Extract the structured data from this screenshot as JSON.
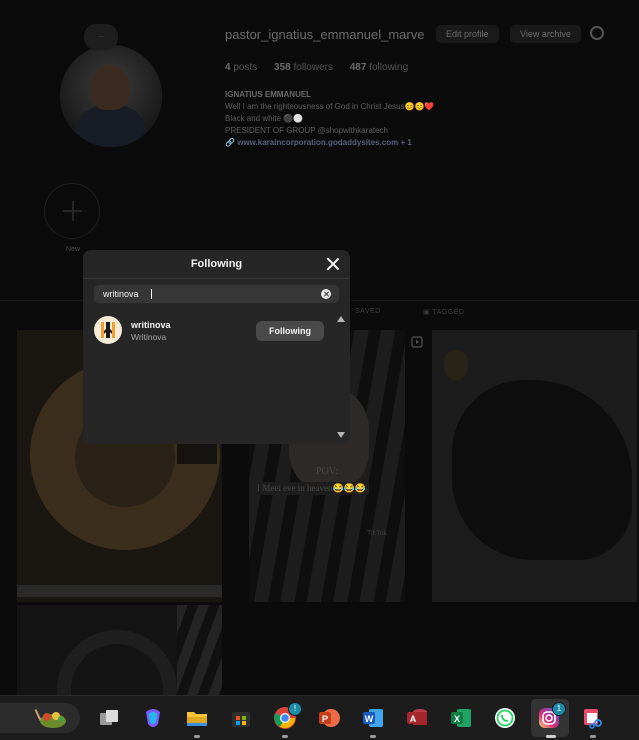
{
  "profile": {
    "username": "pastor_ignatius_emmanuel_marve",
    "edit_profile_label": "Edit profile",
    "view_archive_label": "View archive",
    "stats": {
      "posts_count": "4",
      "posts_label": "posts",
      "followers_count": "358",
      "followers_label": "followers",
      "following_count": "487",
      "following_label": "following"
    },
    "bio": {
      "name": "IGNATIUS EMMANUEL",
      "line1": "Well I am the righteousness of God in Christ Jesus😊😊❤️",
      "line2": "Black and white ⚫⚪",
      "line3": "PRESIDENT OF GROUP @shopwithkaratech",
      "link": "www.karaincorporation.godaddysites.com + 1"
    },
    "new_highlight_label": "New"
  },
  "tabs": {
    "saved_label": "SAVED",
    "tagged_label": "TAGGED"
  },
  "posts": {
    "post2_pov": "POV:",
    "post2_caption": "I Meet eve in heaven😂😂😂",
    "post2_watermark": "TikTok"
  },
  "modal": {
    "title": "Following",
    "search_value": "writinova",
    "results": [
      {
        "username": "writinova",
        "full_name": "Writinova",
        "button_label": "Following"
      }
    ]
  },
  "taskbar": {
    "apps": [
      "widgets",
      "task-view",
      "copilot",
      "file-explorer",
      "microsoft-store",
      "chrome",
      "powerpoint",
      "word",
      "access",
      "excel",
      "whatsapp",
      "instagram",
      "snipping-tool"
    ],
    "chrome_badge": "!",
    "instagram_badge": "1",
    "accent_color": "#1a8ca8"
  }
}
